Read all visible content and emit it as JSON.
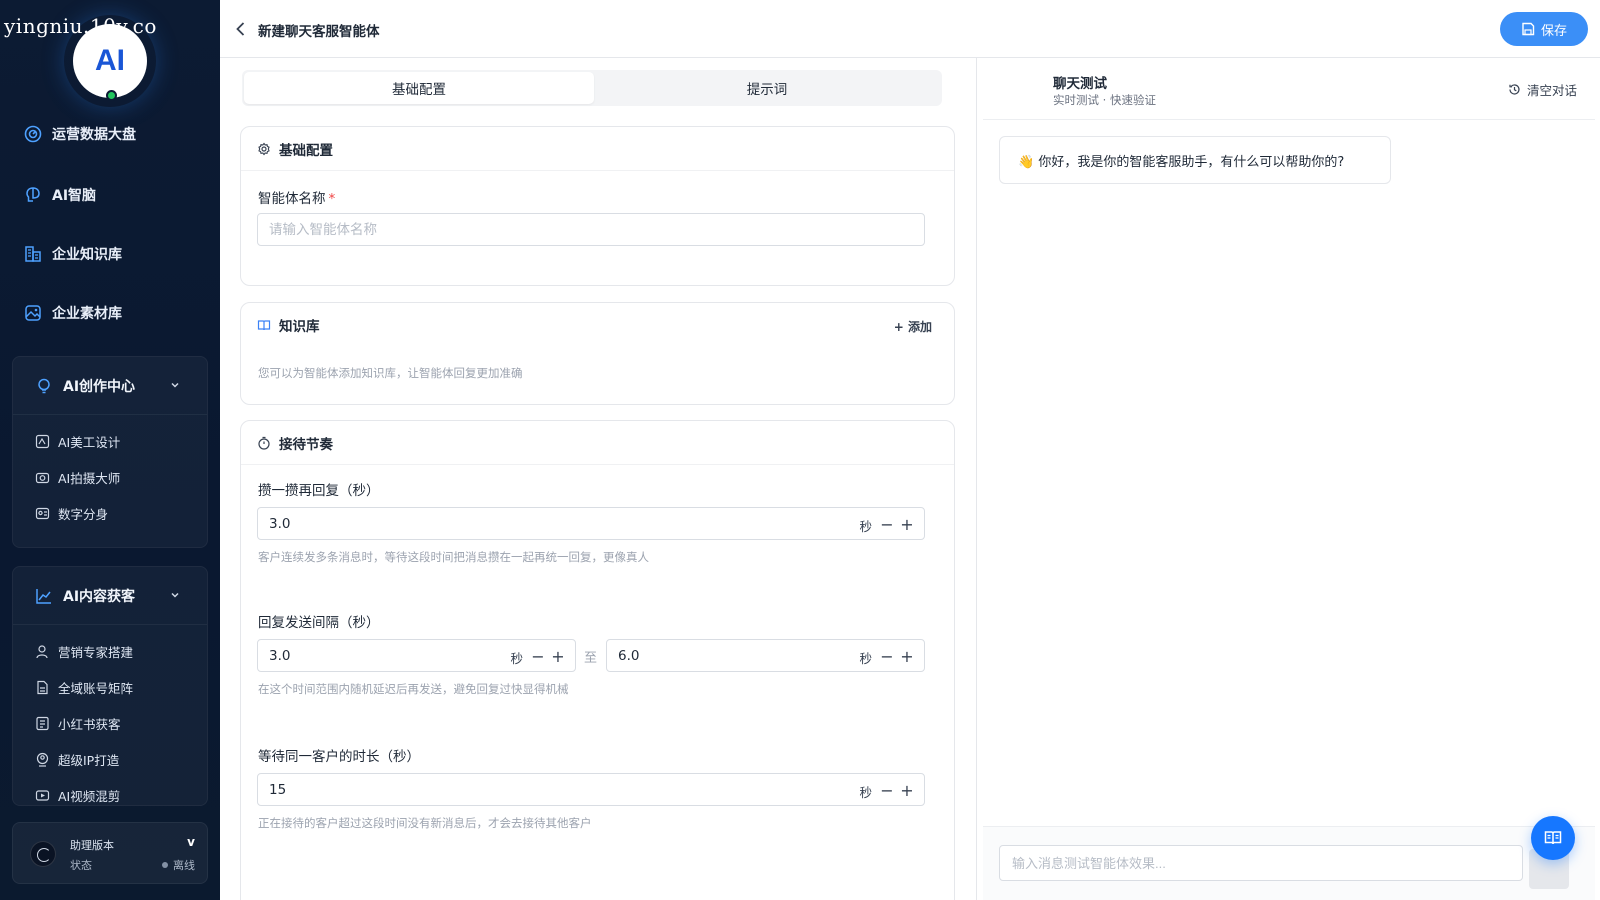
{
  "watermark": "yingniu.10v.co",
  "logo": {
    "text": "AI"
  },
  "sidebar": {
    "nav": [
      {
        "label": "运营数据大盘",
        "icon": "dashboard-icon"
      },
      {
        "label": "AI智脑",
        "icon": "brain-icon"
      },
      {
        "label": "企业知识库",
        "icon": "knowledge-base-icon"
      },
      {
        "label": "企业素材库",
        "icon": "image-library-icon"
      }
    ],
    "groups": [
      {
        "label": "AI创作中心",
        "items": [
          "AI美工设计",
          "AI拍摄大师",
          "数字分身"
        ]
      },
      {
        "label": "AI内容获客",
        "items": [
          "营销专家搭建",
          "全域账号矩阵",
          "小红书获客",
          "超级IP打造",
          "AI视频混剪"
        ]
      }
    ],
    "footer": {
      "title": "助理版本",
      "version": "v",
      "status_label": "状态",
      "status_value": "离线"
    }
  },
  "header": {
    "title": "新建聊天客服智能体",
    "save_label": "保存"
  },
  "config": {
    "tabs": [
      "基础配置",
      "提示词"
    ],
    "basic": {
      "title": "基础配置",
      "name_label": "智能体名称",
      "required_mark": "*",
      "name_placeholder": "请输入智能体名称"
    },
    "knowledge": {
      "title": "知识库",
      "add_label": "+ 添加",
      "hint": "您可以为智能体添加知识库，让智能体回复更加准确"
    },
    "rhythm": {
      "title": "接待节奏",
      "unit": "秒",
      "to": "至",
      "gather": {
        "label": "攒一攒再回复（秒）",
        "value": "3.0",
        "hint": "客户连续发多条消息时，等待这段时间把消息攒在一起再统一回复，更像真人"
      },
      "interval": {
        "label": "回复发送间隔（秒）",
        "min": "3.0",
        "max": "6.0",
        "hint": "在这个时间范围内随机延迟后再发送，避免回复过快显得机械"
      },
      "wait": {
        "label": "等待同一客户的时长（秒）",
        "value": "15",
        "hint": "正在接待的客户超过这段时间没有新消息后，才会去接待其他客户"
      }
    }
  },
  "chat": {
    "title": "聊天测试",
    "subtitle": "实时测试 · 快速验证",
    "clear_label": "清空对话",
    "greeting": "👋 你好，我是你的智能客服助手，有什么可以帮助你的?",
    "input_placeholder": "输入消息测试智能体效果..."
  },
  "colors": {
    "primary": "#3b8ff7",
    "sidebar_bg": "#0c1b33",
    "online": "#22c55e",
    "required": "#ef4444"
  }
}
